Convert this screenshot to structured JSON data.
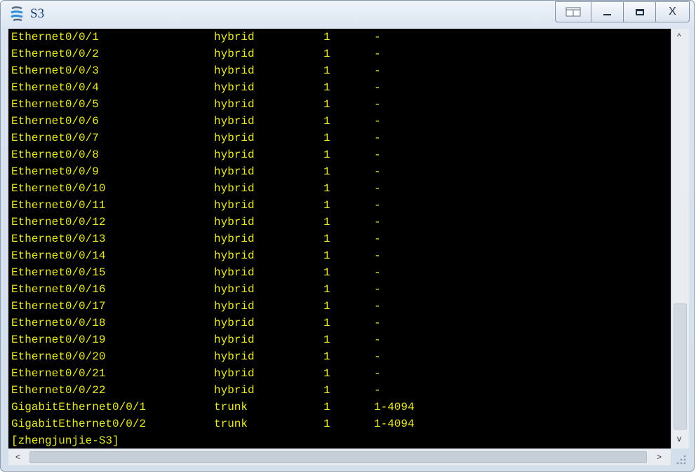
{
  "window": {
    "title": "S3",
    "buttons": {
      "minimize": "minimize",
      "maximize": "maximize",
      "close_label": "X"
    }
  },
  "terminal": {
    "text_color": "#e8e82a",
    "background": "#000000",
    "rows": [
      [
        "Ethernet0/0/1",
        "hybrid",
        "1",
        "-"
      ],
      [
        "Ethernet0/0/2",
        "hybrid",
        "1",
        "-"
      ],
      [
        "Ethernet0/0/3",
        "hybrid",
        "1",
        "-"
      ],
      [
        "Ethernet0/0/4",
        "hybrid",
        "1",
        "-"
      ],
      [
        "Ethernet0/0/5",
        "hybrid",
        "1",
        "-"
      ],
      [
        "Ethernet0/0/6",
        "hybrid",
        "1",
        "-"
      ],
      [
        "Ethernet0/0/7",
        "hybrid",
        "1",
        "-"
      ],
      [
        "Ethernet0/0/8",
        "hybrid",
        "1",
        "-"
      ],
      [
        "Ethernet0/0/9",
        "hybrid",
        "1",
        "-"
      ],
      [
        "Ethernet0/0/10",
        "hybrid",
        "1",
        "-"
      ],
      [
        "Ethernet0/0/11",
        "hybrid",
        "1",
        "-"
      ],
      [
        "Ethernet0/0/12",
        "hybrid",
        "1",
        "-"
      ],
      [
        "Ethernet0/0/13",
        "hybrid",
        "1",
        "-"
      ],
      [
        "Ethernet0/0/14",
        "hybrid",
        "1",
        "-"
      ],
      [
        "Ethernet0/0/15",
        "hybrid",
        "1",
        "-"
      ],
      [
        "Ethernet0/0/16",
        "hybrid",
        "1",
        "-"
      ],
      [
        "Ethernet0/0/17",
        "hybrid",
        "1",
        "-"
      ],
      [
        "Ethernet0/0/18",
        "hybrid",
        "1",
        "-"
      ],
      [
        "Ethernet0/0/19",
        "hybrid",
        "1",
        "-"
      ],
      [
        "Ethernet0/0/20",
        "hybrid",
        "1",
        "-"
      ],
      [
        "Ethernet0/0/21",
        "hybrid",
        "1",
        "-"
      ],
      [
        "Ethernet0/0/22",
        "hybrid",
        "1",
        "-"
      ],
      [
        "GigabitEthernet0/0/1",
        "trunk",
        "1",
        "1-4094"
      ],
      [
        "GigabitEthernet0/0/2",
        "trunk",
        "1",
        "1-4094"
      ]
    ],
    "prompt": "[zhengjunjie-S3]"
  },
  "scrollbars": {
    "up_arrow": "^",
    "down_arrow": "v",
    "left_arrow": "<",
    "right_arrow": ">"
  }
}
